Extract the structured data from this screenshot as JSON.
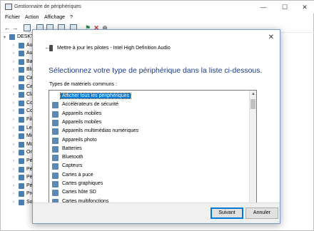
{
  "window": {
    "title": "Gestionnaire de périphériques",
    "minimize": "—",
    "maximize": "☐",
    "close": "✕"
  },
  "menu": [
    "Fichier",
    "Action",
    "Affichage",
    "?"
  ],
  "tree": [
    "DESKTO",
    "Aud",
    "Aut",
    "Bat",
    "Blu",
    "Cam",
    "Car",
    "Cla",
    "Con",
    "Con",
    "File",
    "Lec",
    "Mic",
    "Mo",
    "Ord",
    "Pér",
    "Pér",
    "Pér",
    "Pér",
    "Pro",
    "Sou"
  ],
  "dialog": {
    "close": "✕",
    "back": "←",
    "title": "Mettre à jour les pilotes - Intel High Definition Audio",
    "heading": "Sélectionnez votre type de périphérique dans la liste ci-dessous.",
    "list_label": "Types de matériels communs :",
    "items": [
      {
        "label": "Afficher tous les périphériques",
        "icon": "none",
        "selected": true
      },
      {
        "label": "Accélérateurs de sécurité",
        "icon": "security-accelerator-icon"
      },
      {
        "label": "Appareils mobiles",
        "icon": "mobile-device-icon"
      },
      {
        "label": "Appareils mobiles",
        "icon": "mobile-device-icon"
      },
      {
        "label": "Appareils multimédias numériques",
        "icon": "media-device-icon"
      },
      {
        "label": "Appareils photo",
        "icon": "camera-icon"
      },
      {
        "label": "Batteries",
        "icon": "battery-icon"
      },
      {
        "label": "Bluetooth",
        "icon": "bluetooth-icon"
      },
      {
        "label": "Capteurs",
        "icon": "sensor-icon"
      },
      {
        "label": "Cartes à puce",
        "icon": "smart-card-icon"
      },
      {
        "label": "Cartes graphiques",
        "icon": "graphics-card-icon"
      },
      {
        "label": "Cartes hôte SD",
        "icon": "sd-host-icon"
      },
      {
        "label": "Cartes multifonctions",
        "icon": "multifunction-card-icon"
      }
    ],
    "next": "Suivant",
    "cancel": "Annuler"
  }
}
